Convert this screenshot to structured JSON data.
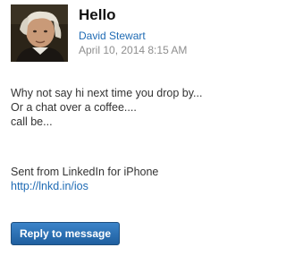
{
  "message": {
    "subject": "Hello",
    "sender_name": "David Stewart",
    "timestamp": "April 10, 2014 8:15 AM",
    "avatar_icon": "profile-photo",
    "body_lines": [
      "Why not say hi next time you drop by...",
      "Or a chat over a coffee....",
      "call be..."
    ],
    "signature_text": "Sent from LinkedIn for iPhone",
    "signature_link": "http://lnkd.in/ios"
  },
  "actions": {
    "reply_label": "Reply to message"
  },
  "colors": {
    "link": "#1f6bb4",
    "button": "#2d6fb0",
    "timestamp": "#8e8e8e"
  }
}
